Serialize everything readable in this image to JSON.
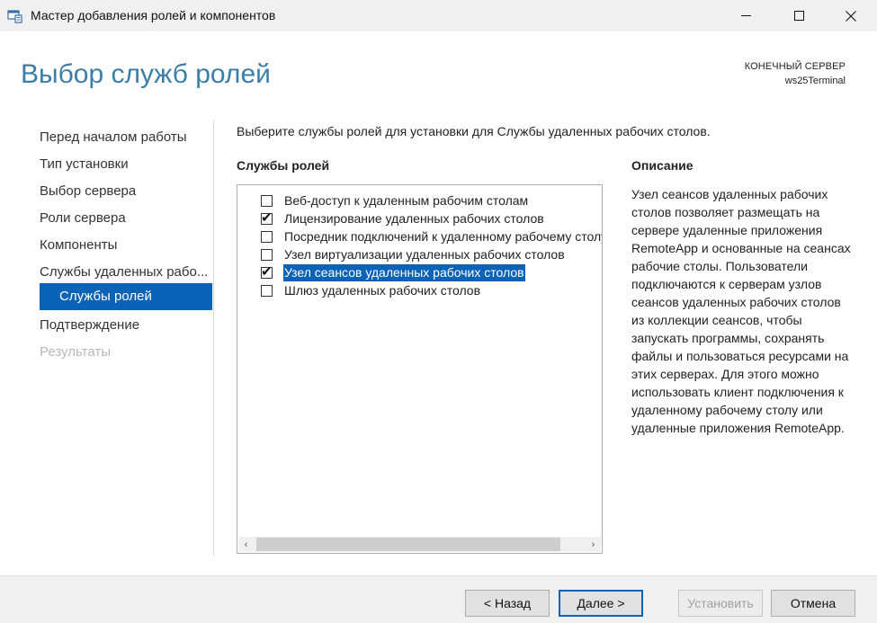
{
  "window": {
    "title": "Мастер добавления ролей и компонентов",
    "minimize_icon": "minimize-icon",
    "maximize_icon": "maximize-icon",
    "close_icon": "close-icon"
  },
  "header": {
    "page_title": "Выбор служб ролей",
    "server_label": "КОНЕЧНЫЙ СЕРВЕР",
    "server_name": "ws25Terminal"
  },
  "nav": {
    "items": [
      {
        "label": "Перед началом работы"
      },
      {
        "label": "Тип установки"
      },
      {
        "label": "Выбор сервера"
      },
      {
        "label": "Роли сервера"
      },
      {
        "label": "Компоненты"
      },
      {
        "label": "Службы удаленных рабо..."
      },
      {
        "label": "Службы ролей"
      },
      {
        "label": "Подтверждение"
      },
      {
        "label": "Результаты"
      }
    ],
    "active_index": 6
  },
  "main": {
    "instruction": "Выберите службы ролей для установки для Службы удаленных рабочих столов.",
    "roles_heading": "Службы ролей",
    "description_heading": "Описание",
    "role_services": [
      {
        "label": "Веб-доступ к удаленным рабочим столам",
        "checked": false,
        "selected": false
      },
      {
        "label": "Лицензирование удаленных рабочих столов",
        "checked": true,
        "selected": false
      },
      {
        "label": "Посредник подключений к удаленному рабочему столу",
        "checked": false,
        "selected": false
      },
      {
        "label": "Узел виртуализации удаленных рабочих столов",
        "checked": false,
        "selected": false
      },
      {
        "label": "Узел сеансов удаленных рабочих столов",
        "checked": true,
        "selected": true
      },
      {
        "label": "Шлюз удаленных рабочих столов",
        "checked": false,
        "selected": false
      }
    ],
    "description": "Узел сеансов удаленных рабочих столов позволяет размещать на сервере удаленные приложения RemoteApp и основанные на сеансах рабочие столы. Пользователи подключаются к серверам узлов сеансов удаленных рабочих столов из коллекции сеансов, чтобы запускать программы, сохранять файлы и пользоваться ресурсами на этих серверах. Для этого можно использовать клиент подключения к удаленному рабочему столу или удаленные приложения RemoteApp."
  },
  "footer": {
    "back_label": "< Назад",
    "next_label": "Далее >",
    "install_label": "Установить",
    "cancel_label": "Отмена"
  },
  "colors": {
    "accent": "#0b63b8",
    "title": "#3b7ea8"
  }
}
